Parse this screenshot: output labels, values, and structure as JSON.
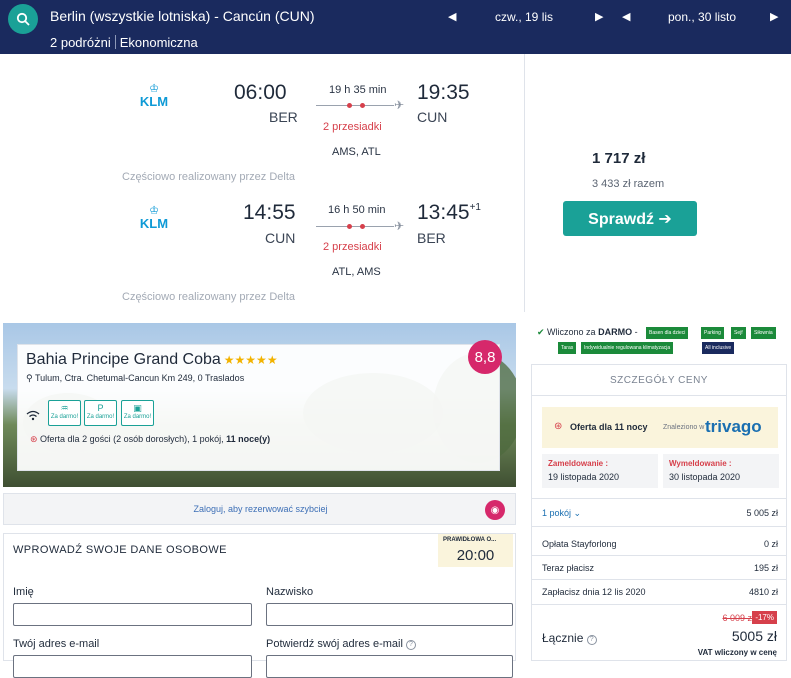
{
  "search": {
    "route": "Berlin (wszystkie lotniska) - Cancún (CUN)",
    "passengers": "2 podróżni",
    "cabin": "Ekonomiczna",
    "depart_date": "czw., 19 lis",
    "return_date": "pon., 30 listo"
  },
  "outbound": {
    "airline": "KLM",
    "dep_time": "06:00",
    "dep_code": "BER",
    "arr_time": "19:35",
    "arr_code": "CUN",
    "duration": "19 h 35 min",
    "stops": "2 przesiadki",
    "via": "AMS, ATL",
    "operated_by": "Częściowo realizowany przez Delta"
  },
  "inbound": {
    "airline": "KLM",
    "dep_time": "14:55",
    "dep_code": "CUN",
    "arr_time": "13:45",
    "arr_offset": "+1",
    "arr_code": "BER",
    "duration": "16 h 50 min",
    "stops": "2 przesiadki",
    "via": "ATL, AMS",
    "operated_by": "Częściowo realizowany przez Delta"
  },
  "price": {
    "per_person": "1 717 zł",
    "total": "3 433 zł razem",
    "check_label": "Sprawdź ➔"
  },
  "hotel": {
    "name": "Bahia Principe Grand Coba",
    "stars": "★★★★★",
    "address": "Tulum, Ctra. Chetumal-Cancun Km 249, 0 Traslados",
    "score": "8,8",
    "amenities": [
      "Za darmo!",
      "Za darmo!",
      "Za darmo!"
    ],
    "offer_text": "Oferta dla 2 gości (2 osób dorosłych), 1 pokój, ",
    "offer_nights": "11 noce(y)"
  },
  "login": {
    "text": "Zaloguj, aby rezerwować szybciej"
  },
  "form": {
    "title": "WPROWADŹ SWOJE DANE OSOBOWE",
    "valid_label": "PRAWIDŁOWA O...",
    "valid_time": "20:00",
    "first_name": "Imię",
    "last_name": "Nazwisko",
    "email": "Twój adres e-mail",
    "email_confirm": "Potwierdź swój adres e-mail"
  },
  "free_amenities": {
    "label_prefix": "Wliczono za ",
    "label_bold": "DARMO",
    "label_suffix": " -",
    "tags": [
      "Basen dla dzieci",
      "Parking",
      "Sejf",
      "Siłownia",
      "Taras",
      "Indywidualnie regulowana klimatyzacja",
      "All inclusive"
    ]
  },
  "details": {
    "title": "SZCZEGÓŁY CENY",
    "offer_nights": "Oferta dla 11 nocy",
    "found_in": "Znaleziono w",
    "trivago": "trivago",
    "checkin_label": "Zameldowanie :",
    "checkin_date": "19 listopada 2020",
    "checkout_label": "Wymeldowanie :",
    "checkout_date": "30 listopada 2020",
    "rooms_label": "1 pokój",
    "rooms_value": "5 005 zł",
    "fee_label": "Opłata Stayforlong",
    "fee_value": "0 zł",
    "now_label": "Teraz płacisz",
    "now_value": "195 zł",
    "later_label": "Zapłacisz dnia 12 lis 2020",
    "later_value": "4810 zł",
    "old_price": "6 009 zł",
    "discount": "-17%",
    "total_label": "Łącznie",
    "total_value": "5005 zł",
    "vat": "VAT wliczony w cenę"
  }
}
